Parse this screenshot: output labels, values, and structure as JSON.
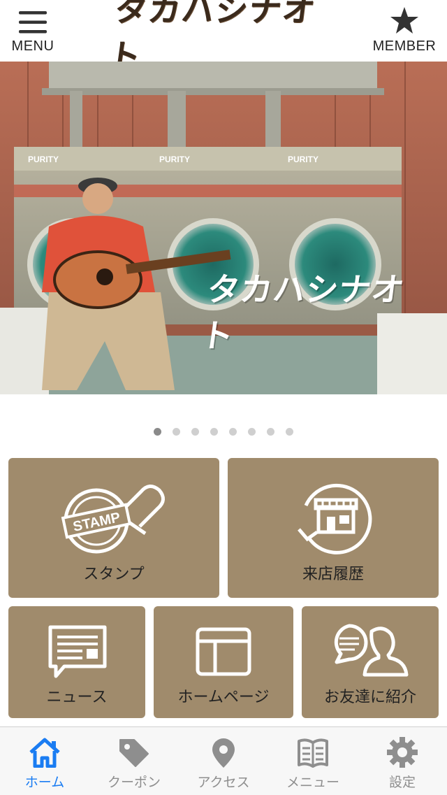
{
  "header": {
    "menu_label": "MENU",
    "member_label": "MEMBER",
    "logo_text": "タカハシナオト"
  },
  "hero": {
    "overlay_text": "タカハシナオト"
  },
  "carousel": {
    "count": 8,
    "active_index": 0
  },
  "tiles": {
    "stamp": {
      "label": "スタンプ",
      "icon": "stamp-icon"
    },
    "visit_history": {
      "label": "来店履歴",
      "icon": "store-history-icon"
    },
    "news": {
      "label": "ニュース",
      "icon": "news-icon"
    },
    "homepage": {
      "label": "ホームページ",
      "icon": "browser-window-icon"
    },
    "refer_friend": {
      "label": "お友達に紹介",
      "icon": "friend-chat-icon"
    }
  },
  "tabbar": {
    "items": [
      {
        "label": "ホーム",
        "icon": "home-icon",
        "active": true
      },
      {
        "label": "クーポン",
        "icon": "tag-icon",
        "active": false
      },
      {
        "label": "アクセス",
        "icon": "map-pin-icon",
        "active": false
      },
      {
        "label": "メニュー",
        "icon": "book-icon",
        "active": false
      },
      {
        "label": "設定",
        "icon": "gear-icon",
        "active": false
      }
    ]
  },
  "colors": {
    "tile_bg": "#a08b6c",
    "active_tab": "#1a7cf2",
    "inactive_tab": "#8e8e8e"
  }
}
